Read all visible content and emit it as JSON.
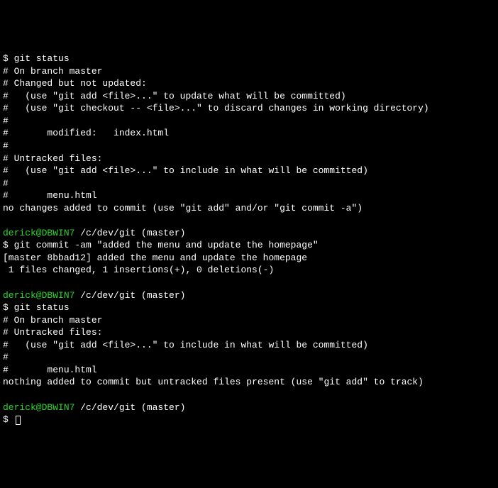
{
  "lines": [
    {
      "segments": [
        {
          "text": "$ git status"
        }
      ]
    },
    {
      "segments": [
        {
          "text": "# On branch master"
        }
      ]
    },
    {
      "segments": [
        {
          "text": "# Changed but not updated:"
        }
      ]
    },
    {
      "segments": [
        {
          "text": "#   (use \"git add <file>...\" to update what will be committed)"
        }
      ]
    },
    {
      "segments": [
        {
          "text": "#   (use \"git checkout -- <file>...\" to discard changes in working directory)"
        }
      ]
    },
    {
      "segments": [
        {
          "text": "#"
        }
      ]
    },
    {
      "segments": [
        {
          "text": "#       modified:   index.html"
        }
      ]
    },
    {
      "segments": [
        {
          "text": "#"
        }
      ]
    },
    {
      "segments": [
        {
          "text": "# Untracked files:"
        }
      ]
    },
    {
      "segments": [
        {
          "text": "#   (use \"git add <file>...\" to include in what will be committed)"
        }
      ]
    },
    {
      "segments": [
        {
          "text": "#"
        }
      ]
    },
    {
      "segments": [
        {
          "text": "#       menu.html"
        }
      ]
    },
    {
      "segments": [
        {
          "text": "no changes added to commit (use \"git add\" and/or \"git commit -a\")"
        }
      ]
    },
    {
      "segments": [
        {
          "text": ""
        }
      ]
    },
    {
      "segments": [
        {
          "text": "derick@DBWIN7 ",
          "cls": "green"
        },
        {
          "text": "/c/dev/git (master)"
        }
      ]
    },
    {
      "segments": [
        {
          "text": "$ git commit -am \"added the menu and update the homepage\""
        }
      ]
    },
    {
      "segments": [
        {
          "text": "[master 8bbad12] added the menu and update the homepage"
        }
      ]
    },
    {
      "segments": [
        {
          "text": " 1 files changed, 1 insertions(+), 0 deletions(-)"
        }
      ]
    },
    {
      "segments": [
        {
          "text": ""
        }
      ]
    },
    {
      "segments": [
        {
          "text": "derick@DBWIN7 ",
          "cls": "green"
        },
        {
          "text": "/c/dev/git (master)"
        }
      ]
    },
    {
      "segments": [
        {
          "text": "$ git status"
        }
      ]
    },
    {
      "segments": [
        {
          "text": "# On branch master"
        }
      ]
    },
    {
      "segments": [
        {
          "text": "# Untracked files:"
        }
      ]
    },
    {
      "segments": [
        {
          "text": "#   (use \"git add <file>...\" to include in what will be committed)"
        }
      ]
    },
    {
      "segments": [
        {
          "text": "#"
        }
      ]
    },
    {
      "segments": [
        {
          "text": "#       menu.html"
        }
      ]
    },
    {
      "segments": [
        {
          "text": "nothing added to commit but untracked files present (use \"git add\" to track)"
        }
      ]
    },
    {
      "segments": [
        {
          "text": ""
        }
      ]
    },
    {
      "segments": [
        {
          "text": "derick@DBWIN7 ",
          "cls": "green"
        },
        {
          "text": "/c/dev/git (master)"
        }
      ]
    }
  ],
  "prompt": "$ ",
  "cursor": true
}
